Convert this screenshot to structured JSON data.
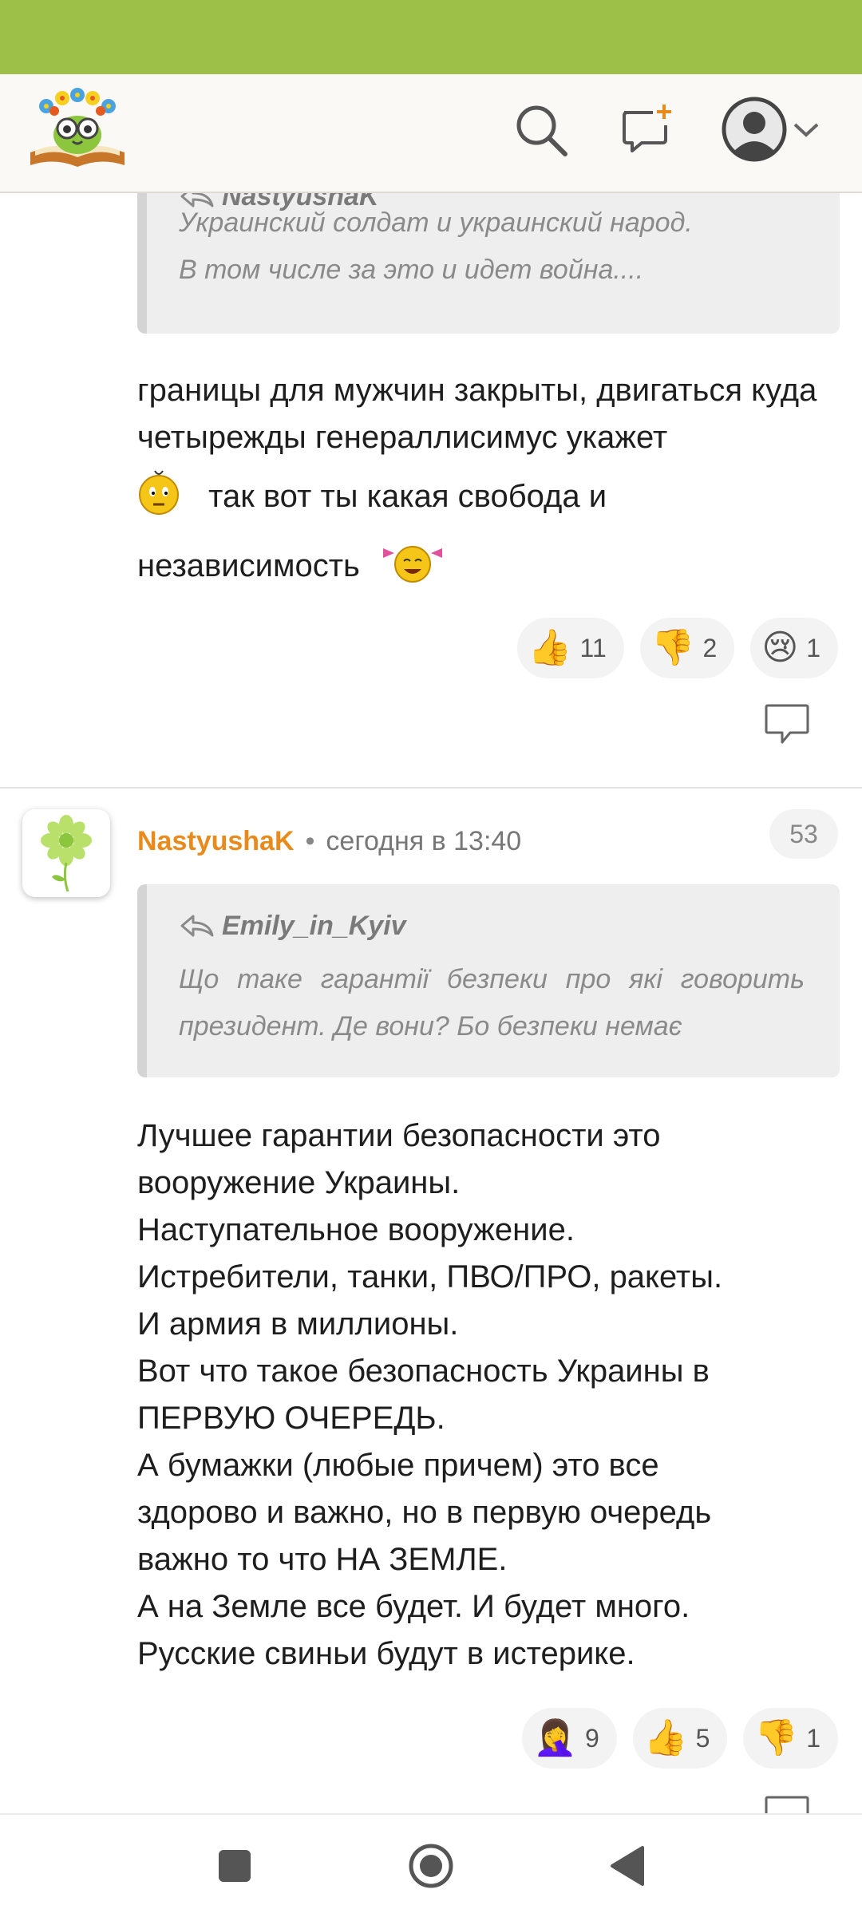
{
  "header": {
    "logo_icon": "book-owl-logo-icon",
    "search_icon": "search-icon",
    "new_post_icon": "add-comment-icon",
    "profile_icon": "user-avatar-icon",
    "menu_icon": "chevron-down-icon"
  },
  "comment1": {
    "quote_author": "NastyushaK",
    "quote_lines": [
      "Украинский солдат и украинский народ.",
      "В том числе за это и идет война...."
    ],
    "text_part1": "границы для мужчин закрыты, двигаться куда четырежды генераллисимус укажет",
    "text_part2": "так вот ты какая свобода и",
    "text_part3": "независимость",
    "reactions": [
      {
        "emoji": "👍",
        "count": "11"
      },
      {
        "emoji": "👎",
        "count": "2"
      },
      {
        "emoji": "😢",
        "count": "1"
      }
    ]
  },
  "comment2": {
    "username": "NastyushaK",
    "separator": "•",
    "timestamp": "сегодня в 13:40",
    "comment_count": "53",
    "quote_author": "Emily_in_Kyiv",
    "quote_lines": [
      "Що таке гарантії безпеки про які говорить",
      "президент. Де вони? Бо безпеки немає"
    ],
    "text_lines": [
      "Лучшее гарантии безопасности это",
      "вооружение Украины.",
      "Наступательное вооружение.",
      "Истребители, танки, ПВО/ПРО, ракеты.",
      "И армия в миллионы.",
      "Вот что такое безопасность Украины в",
      "ПЕРВУЮ ОЧЕРЕДЬ.",
      "А бумажки (любые причем) это все",
      "здорово и важно, но в первую очередь",
      "важно то что НА ЗЕМЛЕ.",
      "А на Земле все будет. И будет много.",
      "Русские свиньи будут в истерике."
    ],
    "reactions": [
      {
        "emoji": "🤦‍♀️",
        "count": "9"
      },
      {
        "emoji": "👍",
        "count": "5"
      },
      {
        "emoji": "👎",
        "count": "1"
      }
    ]
  },
  "colors": {
    "status_bar": "#9dc148",
    "username": "#e98a1d",
    "quote_bg": "#eeeeee"
  }
}
